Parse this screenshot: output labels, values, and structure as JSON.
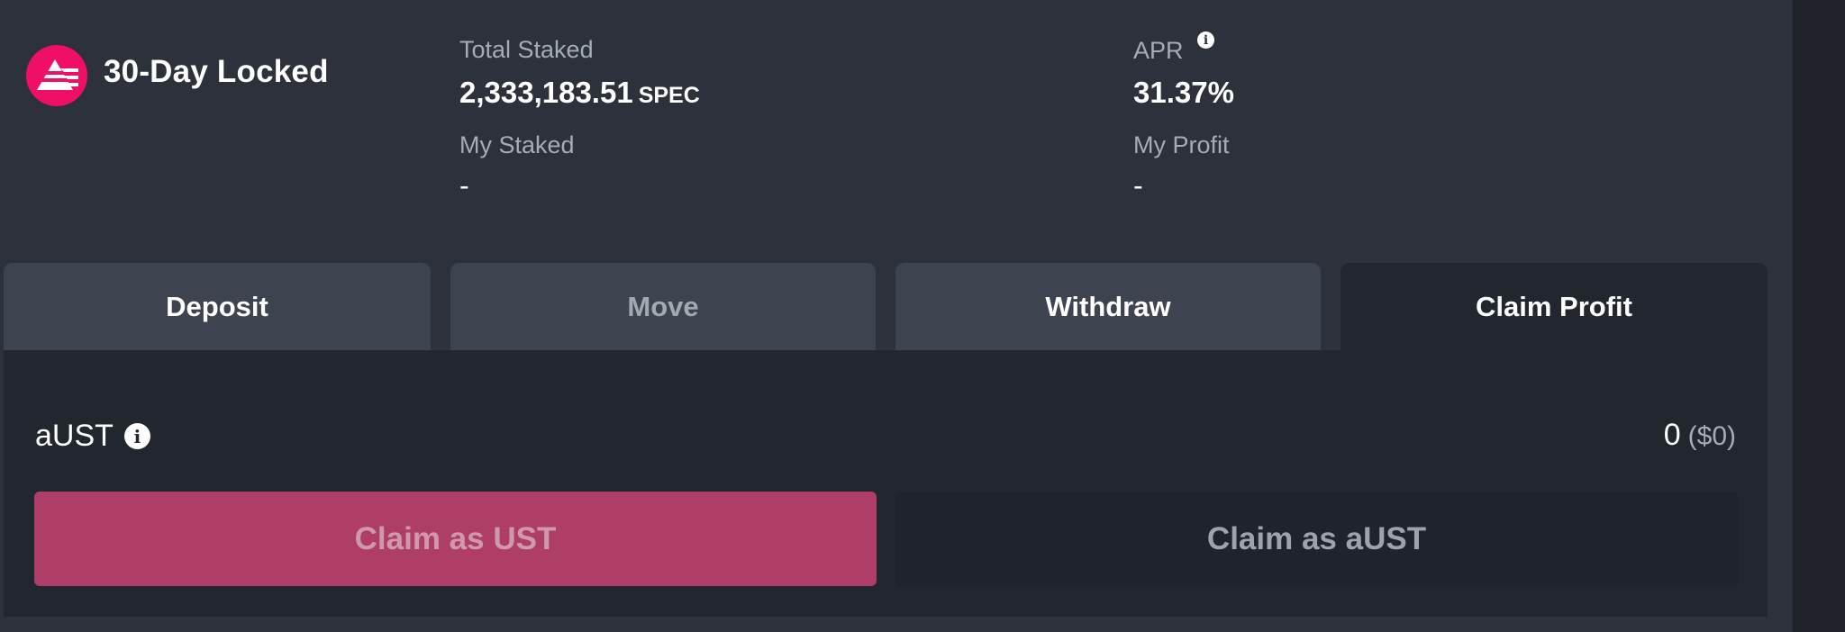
{
  "pool": {
    "title": "30-Day Locked",
    "logo_icon": "anchor-protocol-icon",
    "logo_color": "#ef0f66"
  },
  "stats": {
    "total_staked_label": "Total Staked",
    "total_staked_value": "2,333,183.51",
    "total_staked_unit": "SPEC",
    "my_staked_label": "My Staked",
    "my_staked_value": "-",
    "apr_label": "APR",
    "apr_value": "31.37%",
    "my_profit_label": "My Profit",
    "my_profit_value": "-"
  },
  "tabs": [
    {
      "label": "Deposit",
      "state": "enabled"
    },
    {
      "label": "Move",
      "state": "disabled"
    },
    {
      "label": "Withdraw",
      "state": "enabled"
    },
    {
      "label": "Claim Profit",
      "state": "active"
    }
  ],
  "claim": {
    "asset_label": "aUST",
    "amount": "0",
    "amount_usd": "($0)",
    "claim_ust_label": "Claim as UST",
    "claim_aust_label": "Claim as aUST"
  },
  "colors": {
    "background": "#2c313c",
    "content_bg": "#22262e",
    "primary_button": "#ae3d67",
    "tab_bg": "#3e444f"
  }
}
